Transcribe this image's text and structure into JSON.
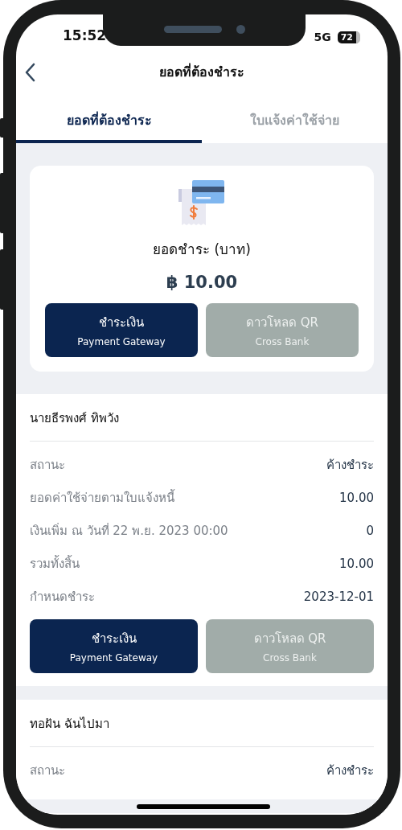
{
  "status_bar": {
    "time": "15:52",
    "network": "5G",
    "battery": "72"
  },
  "nav": {
    "title": "ยอดที่ต้องชำระ"
  },
  "tabs": [
    {
      "label": "ยอดที่ต้องชำระ",
      "selected": true
    },
    {
      "label": "ใบแจ้งค่าใช้จ่าย",
      "selected": false
    }
  ],
  "summary": {
    "title": "ยอดชำระ (บาท)",
    "amount": "฿ 10.00",
    "buttons": [
      {
        "label": "ชำระเงิน",
        "sublabel": "Payment Gateway",
        "kind": "primary"
      },
      {
        "label": "ดาวโหลด QR",
        "sublabel": "Cross Bank",
        "kind": "secondary"
      }
    ]
  },
  "bills": [
    {
      "name": "นายธีรพงศ์ ทิพวัง",
      "rows": [
        {
          "label": "สถานะ",
          "value": "ค้างชำระ"
        },
        {
          "label": "ยอดค่าใช้จ่ายตามใบแจ้งหนี้",
          "value": "10.00"
        },
        {
          "label": "เงินเพิ่ม ณ วันที่ 22 พ.ย. 2023 00:00",
          "value": "0"
        },
        {
          "label": "รวมทั้งสิ้น",
          "value": "10.00"
        },
        {
          "label": "กำหนดชำระ",
          "value": "2023-12-01"
        }
      ],
      "buttons": [
        {
          "label": "ชำระเงิน",
          "sublabel": "Payment Gateway",
          "kind": "primary"
        },
        {
          "label": "ดาวโหลด QR",
          "sublabel": "Cross Bank",
          "kind": "secondary"
        }
      ]
    },
    {
      "name": "ทอฝัน ฉันไปมา",
      "rows": [
        {
          "label": "สถานะ",
          "value": "ค้างชำระ"
        }
      ]
    }
  ]
}
